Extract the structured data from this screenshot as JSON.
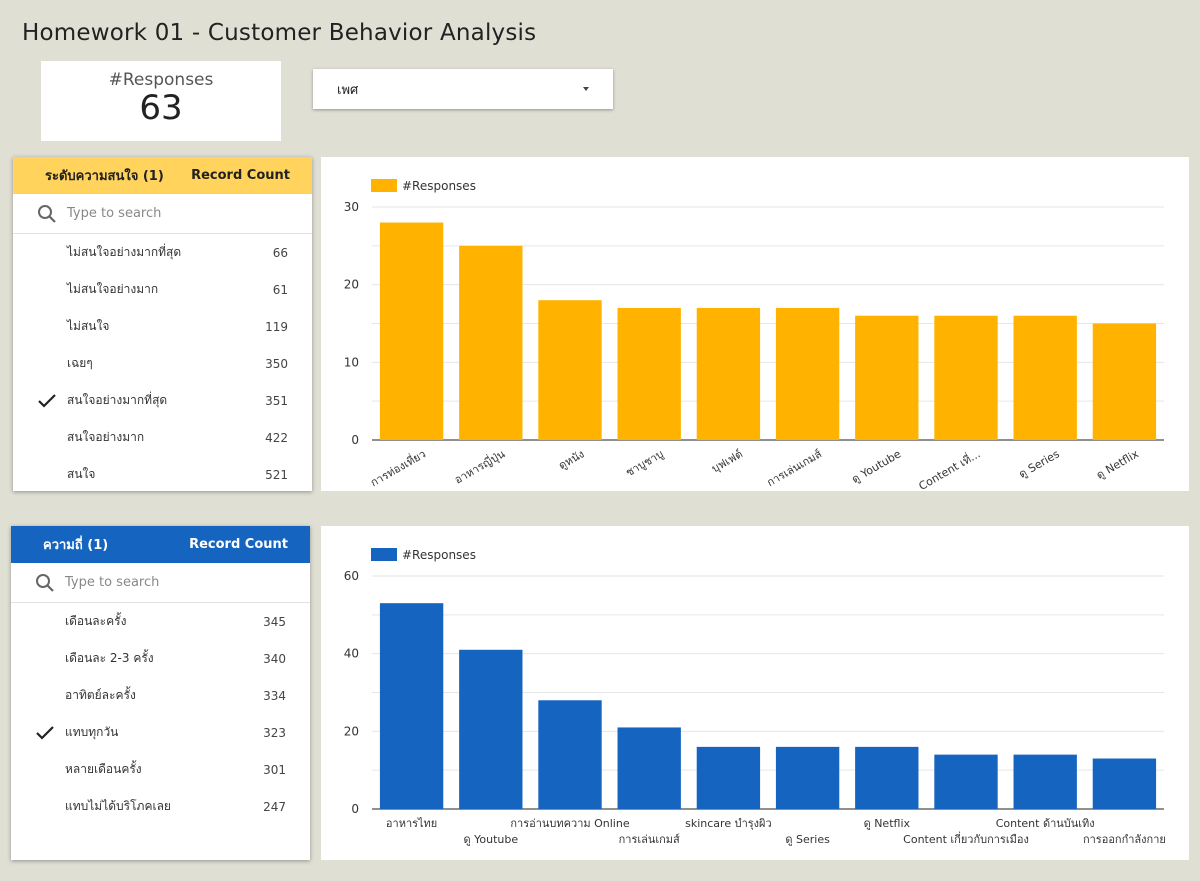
{
  "title": "Homework 01 - Customer Behavior Analysis",
  "scorecard": {
    "label": "#Responses",
    "value": "63"
  },
  "dropdown": {
    "label": "เพศ",
    "icon": "chevron-down-icon"
  },
  "filter1": {
    "header": "ระดับความสนใจ (1)",
    "count_header": "Record Count",
    "color": "#ffd35c",
    "search_placeholder": "Type to search",
    "rows": [
      {
        "label": "ไม่สนใจอย่างมากที่สุด",
        "count": "66",
        "checked": false
      },
      {
        "label": "ไม่สนใจอย่างมาก",
        "count": "61",
        "checked": false
      },
      {
        "label": "ไม่สนใจ",
        "count": "119",
        "checked": false
      },
      {
        "label": "เฉยๆ",
        "count": "350",
        "checked": false
      },
      {
        "label": "สนใจอย่างมากที่สุด",
        "count": "351",
        "checked": true
      },
      {
        "label": "สนใจอย่างมาก",
        "count": "422",
        "checked": false
      },
      {
        "label": "สนใจ",
        "count": "521",
        "checked": false
      }
    ]
  },
  "filter2": {
    "header": "ความถี่ (1)",
    "count_header": "Record Count",
    "color": "#1565c0",
    "search_placeholder": "Type to search",
    "rows": [
      {
        "label": "เดือนละครั้ง",
        "count": "345",
        "checked": false
      },
      {
        "label": "เดือนละ 2-3 ครั้ง",
        "count": "340",
        "checked": false
      },
      {
        "label": "อาทิตย์ละครั้ง",
        "count": "334",
        "checked": false
      },
      {
        "label": "แทบทุกวัน",
        "count": "323",
        "checked": true
      },
      {
        "label": "หลายเดือนครั้ง",
        "count": "301",
        "checked": false
      },
      {
        "label": "แทบไม่ได้บริโภคเลย",
        "count": "247",
        "checked": false
      }
    ]
  },
  "chart_data": [
    {
      "type": "bar",
      "color": "#ffb300",
      "series": [
        {
          "name": "#Responses",
          "values": [
            28,
            25,
            18,
            17,
            17,
            17,
            16,
            16,
            16,
            15
          ]
        }
      ],
      "categories": [
        "การท่องเที่ยว",
        "อาหารญี่ปุ่น",
        "ดูหนัง",
        "ชาบูชาบู",
        "บุฟเฟต์",
        "การเล่นเกมส์",
        "ดู Youtube",
        "Content เที่...",
        "ดู Series",
        "ดู Netflix"
      ],
      "ylim": [
        0,
        30
      ],
      "yticks": [
        0,
        10,
        20,
        30
      ],
      "legend": "top-left",
      "grid": true,
      "label_style": "rotated"
    },
    {
      "type": "bar",
      "color": "#1565c0",
      "series": [
        {
          "name": "#Responses",
          "values": [
            53,
            41,
            28,
            21,
            16,
            16,
            16,
            14,
            14,
            13
          ]
        }
      ],
      "categories": [
        "อาหารไทย",
        "ดู Youtube",
        "การอ่านบทความ Online",
        "การเล่นเกมส์",
        "skincare บำรุงผิว",
        "ดู Series",
        "ดู Netflix",
        "Content เกี่ยวกับการเมือง",
        "Content ด้านบันเทิง",
        "การออกกำลังกาย"
      ],
      "ylim": [
        0,
        60
      ],
      "yticks": [
        0,
        20,
        40,
        60
      ],
      "legend": "top-left",
      "grid": true,
      "label_style": "staggered"
    }
  ]
}
